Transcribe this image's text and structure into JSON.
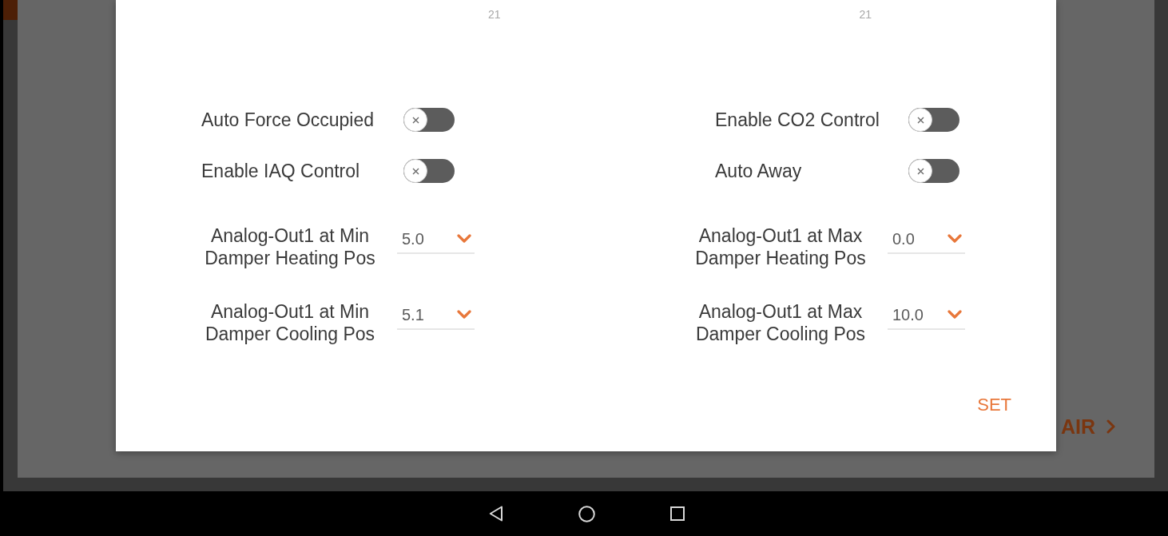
{
  "background": {
    "link": {
      "label": "AIR"
    }
  },
  "dialog": {
    "tick_labels": [
      "21",
      "21"
    ],
    "toggles": [
      {
        "label": "Auto Force Occupied",
        "on": false
      },
      {
        "label": "Enable CO2 Control",
        "on": false
      },
      {
        "label": "Enable IAQ Control",
        "on": false
      },
      {
        "label": "Auto Away",
        "on": false
      }
    ],
    "dropdowns": [
      {
        "label": "Analog-Out1 at Min Damper Heating Pos",
        "value": "5.0"
      },
      {
        "label": "Analog-Out1 at Max Damper Heating Pos",
        "value": "0.0"
      },
      {
        "label": "Analog-Out1 at Min Damper Cooling Pos",
        "value": "5.1"
      },
      {
        "label": "Analog-Out1 at Max Damper Cooling Pos",
        "value": "10.0"
      }
    ],
    "set_button": {
      "label": "SET"
    }
  }
}
